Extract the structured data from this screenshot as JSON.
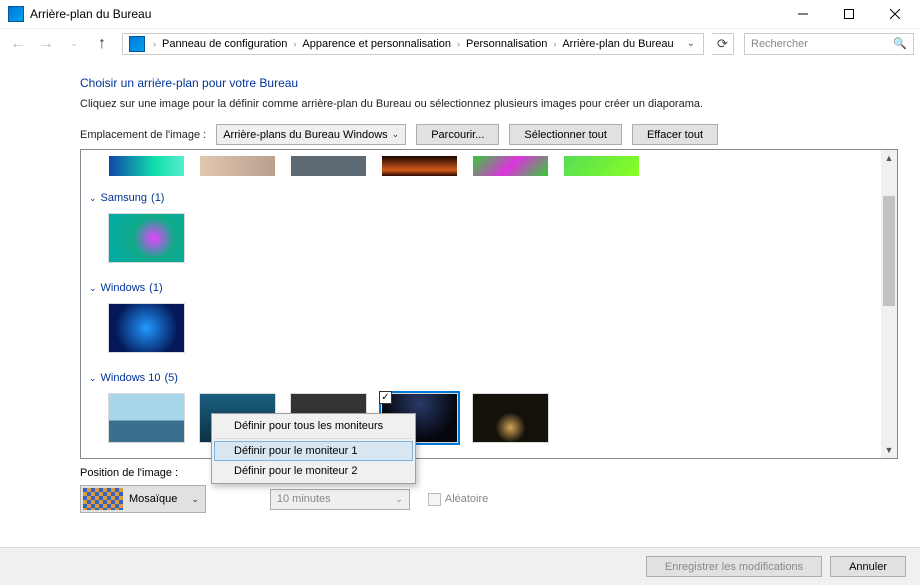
{
  "window": {
    "title": "Arrière-plan du Bureau"
  },
  "breadcrumb": {
    "items": [
      "Panneau de configuration",
      "Apparence et personnalisation",
      "Personnalisation",
      "Arrière-plan du Bureau"
    ]
  },
  "search": {
    "placeholder": "Rechercher"
  },
  "page": {
    "title": "Choisir un arrière-plan pour votre Bureau",
    "subtitle": "Cliquez sur une image pour la définir comme arrière-plan du Bureau ou sélectionnez plusieurs images pour créer un diaporama."
  },
  "location": {
    "label": "Emplacement de l'image :",
    "value": "Arrière-plans du Bureau Windows",
    "browse": "Parcourir...",
    "select_all": "Sélectionner tout",
    "clear_all": "Effacer tout"
  },
  "groups": {
    "samsung": {
      "label": "Samsung",
      "count": "(1)"
    },
    "windows": {
      "label": "Windows",
      "count": "(1)"
    },
    "windows10": {
      "label": "Windows 10",
      "count": "(5)"
    }
  },
  "position": {
    "label": "Position de l'image :",
    "value": "Mosaïque",
    "interval": "10 minutes",
    "random": "Aléatoire"
  },
  "context_menu": {
    "all_monitors": "Définir pour tous les moniteurs",
    "monitor1": "Définir pour le moniteur 1",
    "monitor2": "Définir pour le moniteur 2"
  },
  "buttons": {
    "save": "Enregistrer les modifications",
    "cancel": "Annuler"
  }
}
